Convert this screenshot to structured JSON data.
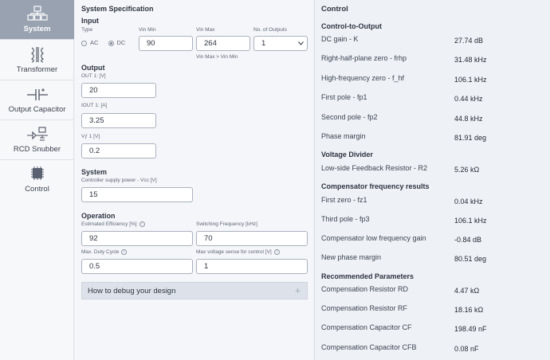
{
  "sidebar": {
    "items": [
      {
        "label": "System",
        "icon": "system-icon",
        "active": true
      },
      {
        "label": "Transformer",
        "icon": "transformer-icon",
        "active": false
      },
      {
        "label": "Output Capacitor",
        "icon": "capacitor-icon",
        "active": false
      },
      {
        "label": "RCD Snubber",
        "icon": "snubber-icon",
        "active": false
      },
      {
        "label": "Control",
        "icon": "chip-icon",
        "active": false
      }
    ]
  },
  "spec": {
    "title": "System Specification",
    "input": {
      "title": "Input",
      "type_label": "Type",
      "ac_label": "AC",
      "dc_label": "DC",
      "vin_min_label": "Vin Min",
      "vin_min_value": "90",
      "vin_max_label": "Vin Max",
      "vin_max_value": "264",
      "vin_hint": "Vin Max > Vin Min",
      "outputs_label": "No. of Outputs",
      "outputs_value": "1"
    },
    "output": {
      "title": "Output",
      "out1_label": "OUT 1: [V]",
      "out1_value": "20",
      "iout1_label": "IOUT 1: [A]",
      "iout1_value": "3.25",
      "vf1_label": "Vƒ 1 [V]",
      "vf1_value": "0.2"
    },
    "system": {
      "title": "System",
      "vcc_label": "Controller supply power - Vcc [V]",
      "vcc_value": "15"
    },
    "operation": {
      "title": "Operation",
      "eff_label": "Estimated Efficiency [%]",
      "eff_value": "92",
      "fsw_label": "Switching Frequency [kHz]",
      "fsw_value": "70",
      "duty_label": "Max. Duty Cycle",
      "duty_value": "0.5",
      "vsense_label": "Max voltage sense for control [V]",
      "vsense_value": "1"
    },
    "debug_label": "How to debug your design",
    "debug_plus": "+"
  },
  "control": {
    "title": "Control",
    "c2o_title": "Control-to-Output",
    "c2o": [
      {
        "label": "DC gain - K",
        "value": "27.74 dB"
      },
      {
        "label": "Right-half-plane zero - frhp",
        "value": "31.48 kHz"
      },
      {
        "label": "High-frequency zero - f_hf",
        "value": "106.1 kHz"
      },
      {
        "label": "First pole - fp1",
        "value": "0.44 kHz"
      },
      {
        "label": "Second pole - fp2",
        "value": "44.8 kHz"
      },
      {
        "label": "Phase margin",
        "value": "81.91 deg"
      }
    ],
    "vd_title": "Voltage Divider",
    "vd": [
      {
        "label": "Low-side Feedback Resistor - R2",
        "value": "5.26 kΩ"
      }
    ],
    "comp_title": "Compensator frequency results",
    "comp": [
      {
        "label": "First zero - fz1",
        "value": "0.04 kHz"
      },
      {
        "label": "Third pole - fp3",
        "value": "106.1 kHz"
      },
      {
        "label": "Compensator low frequency gain",
        "value": "-0.84 dB"
      },
      {
        "label": "New phase margin",
        "value": "80.51 deg"
      }
    ],
    "rec_title": "Recommended Parameters",
    "rec": [
      {
        "label": "Compensation Resistor RD",
        "value": "4.47 kΩ"
      },
      {
        "label": "Compensation Resistor RF",
        "value": "18.16 kΩ"
      },
      {
        "label": "Compensation Capacitor CF",
        "value": "198.49 nF"
      },
      {
        "label": "Compensation Capacitor CFB",
        "value": "0.08 nF"
      }
    ]
  },
  "colors": {
    "active_nav": "#98a2b1",
    "panel_bg": "#f4f6fa",
    "right_bg": "#eef1f6"
  }
}
